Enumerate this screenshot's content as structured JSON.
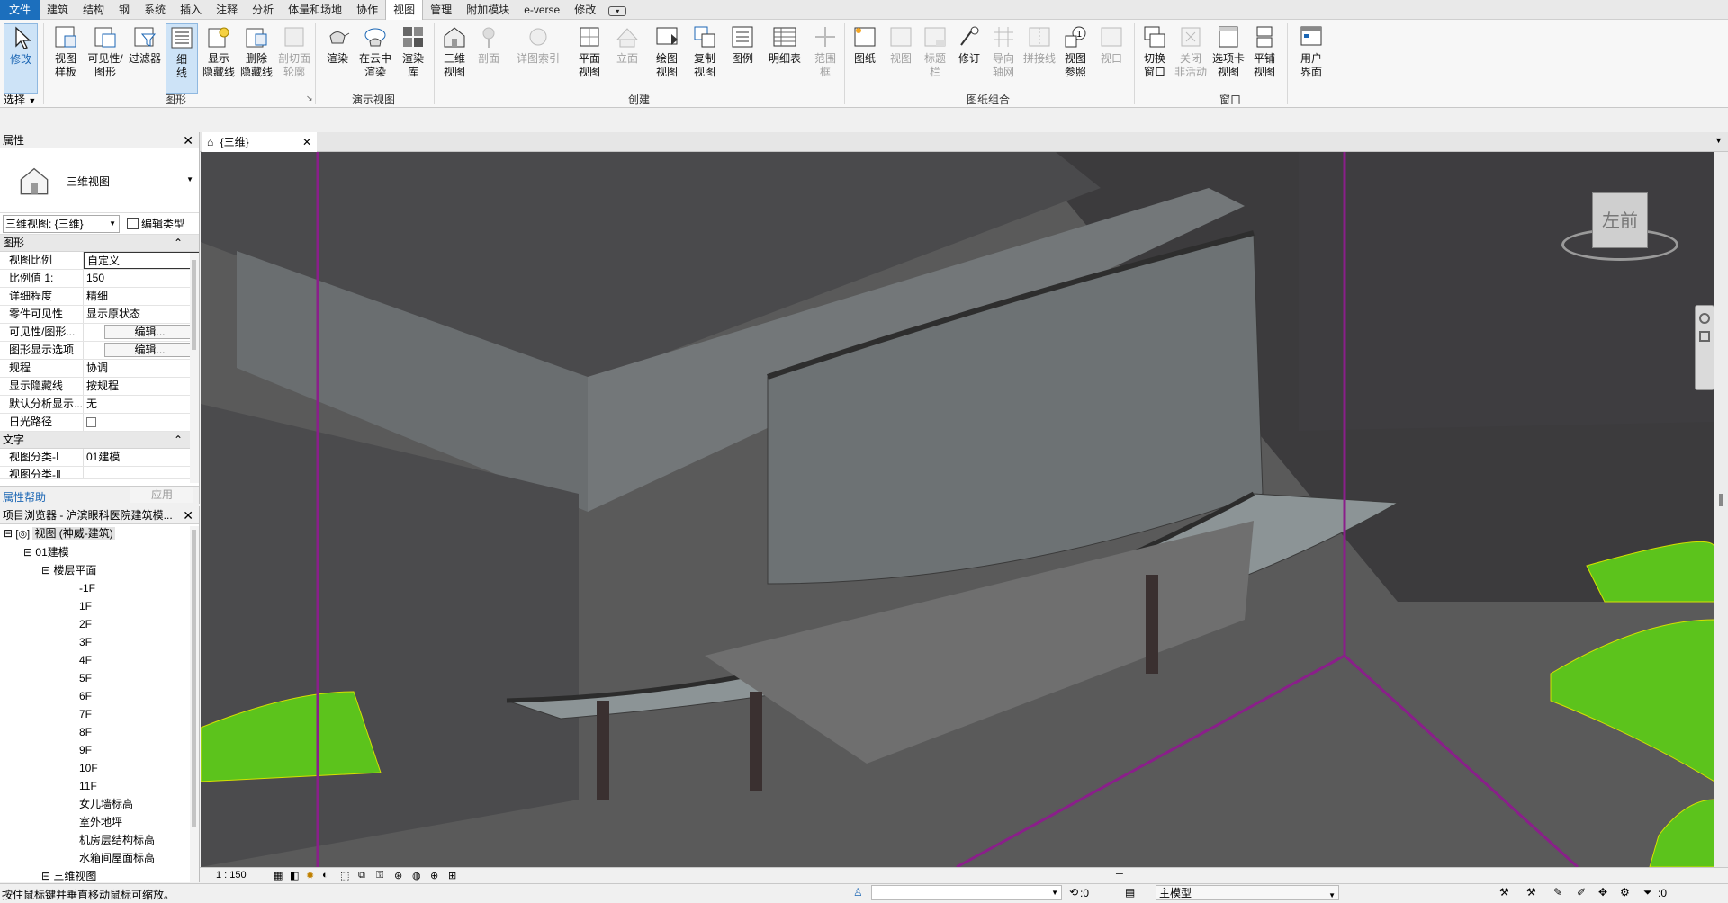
{
  "tabs": [
    "文件",
    "建筑",
    "结构",
    "钢",
    "系统",
    "插入",
    "注释",
    "分析",
    "体量和场地",
    "协作",
    "视图",
    "管理",
    "附加模块",
    "e-verse",
    "修改"
  ],
  "ribbon": {
    "modify": "修改",
    "select": "选择",
    "buttons": {
      "view_template": [
        "视图",
        "样板"
      ],
      "visibility": [
        "可见性/",
        "图形"
      ],
      "filter": "过滤器",
      "thin_lines": [
        "细",
        "线"
      ],
      "show_hidden": [
        "显示",
        "隐藏线"
      ],
      "remove_hidden": [
        "删除",
        "隐藏线"
      ],
      "cut_profile": [
        "剖切面",
        "轮廓"
      ],
      "render": "渲染",
      "cloud_render": [
        "在云中",
        "渲染"
      ],
      "render_gallery": [
        "渲染",
        "库"
      ],
      "3d_view": [
        "三维",
        "视图"
      ],
      "section": "剖面",
      "callout": "详图索引",
      "plan_views": [
        "平面",
        "视图"
      ],
      "elevation": "立面",
      "drafting_view": [
        "绘图",
        "视图"
      ],
      "duplicate_view": [
        "复制",
        "视图"
      ],
      "legends": "图例",
      "schedules": "明细表",
      "scope_box": [
        "范围",
        "框"
      ],
      "sheet": "图纸",
      "view": "视图",
      "title_block": [
        "标题",
        "栏"
      ],
      "revisions": "修订",
      "guide_grid": [
        "导向",
        "轴网"
      ],
      "matchline": "拼接线",
      "view_reference": [
        "视图",
        "参照"
      ],
      "viewports": "视口",
      "switch_windows": [
        "切换",
        "窗口"
      ],
      "close_inactive": [
        "关闭",
        "非活动"
      ],
      "tab_views": [
        "选项卡",
        "视图"
      ],
      "tile_views": [
        "平铺",
        "视图"
      ],
      "user_interface": [
        "用户",
        "界面"
      ]
    },
    "groups": {
      "graphics": "图形",
      "presentation": "演示视图",
      "create": "创建",
      "sheet_composition": "图纸组合",
      "windows": "窗口"
    }
  },
  "properties": {
    "title": "属性",
    "type_name": "三维视图",
    "selector": "三维视图: {三维}",
    "edit_type": "编辑类型",
    "sec_graphics": "图形",
    "rows": [
      {
        "k": "视图比例",
        "v": "自定义"
      },
      {
        "k": "比例值 1:",
        "v": "150"
      },
      {
        "k": "详细程度",
        "v": "精细"
      },
      {
        "k": "零件可见性",
        "v": "显示原状态"
      },
      {
        "k": "可见性/图形...",
        "v": "编辑..."
      },
      {
        "k": "图形显示选项",
        "v": "编辑..."
      },
      {
        "k": "规程",
        "v": "协调"
      },
      {
        "k": "显示隐藏线",
        "v": "按规程"
      },
      {
        "k": "默认分析显示...",
        "v": "无"
      },
      {
        "k": "日光路径",
        "v": ""
      }
    ],
    "sec_text": "文字",
    "text_rows": [
      {
        "k": "视图分类-Ⅰ",
        "v": "01建模"
      },
      {
        "k": "视图分类-Ⅱ",
        "v": ""
      }
    ],
    "help": "属性帮助",
    "apply": "应用"
  },
  "browser": {
    "title": "项目浏览器 - 沪滨眼科医院建筑模...",
    "root": "视图 (神威-建筑)",
    "group": "01建模",
    "floor_plans": "楼层平面",
    "levels": [
      "-1F",
      "1F",
      "2F",
      "3F",
      "4F",
      "5F",
      "6F",
      "7F",
      "8F",
      "9F",
      "10F",
      "11F",
      "女儿墙标高",
      "室外地坪",
      "机房层结构标高",
      "水箱间屋面标高"
    ],
    "views3d": "三维视图"
  },
  "view": {
    "tab": "{三维}",
    "scale": "1 : 150",
    "cube_left": "左",
    "cube_front": "前"
  },
  "status": {
    "hint": "按住鼠标键并垂直移动鼠标可缩放。",
    "zero1": ":0",
    "model": "主模型",
    "zero2": ":0"
  }
}
